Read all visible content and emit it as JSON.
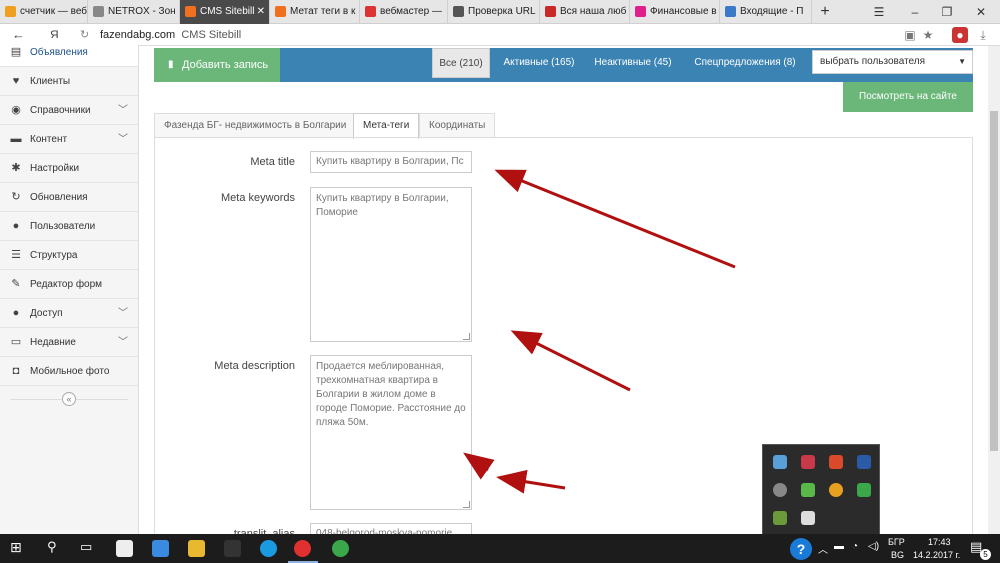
{
  "browser": {
    "tabs": [
      {
        "label": "счетчик — веб",
        "color": "#f0a020"
      },
      {
        "label": "NETROX - Зон",
        "color": "#888888"
      },
      {
        "label": "CMS Sitebill",
        "color": "#f07020"
      },
      {
        "label": "Метат теги в к",
        "color": "#f07020"
      },
      {
        "label": "вебмастер —",
        "color": "#d33333"
      },
      {
        "label": "Проверка URL",
        "color": "#555555"
      },
      {
        "label": "Вся наша люб",
        "color": "#c82828"
      },
      {
        "label": "Финансовые в",
        "color": "#e0208a"
      },
      {
        "label": "Входящие - П",
        "color": "#3a7ac8"
      }
    ],
    "url_domain": "fazendabg.com",
    "url_title": "CMS Sitebill",
    "yandex_glyph": "Я",
    "new_tab": "+",
    "close_tab_glyph": "✕"
  },
  "sidebar": {
    "items": [
      {
        "label": "Объявления",
        "icon": "book-icon",
        "glyph": "▤",
        "chevron": false
      },
      {
        "label": "Клиенты",
        "icon": "heart-icon",
        "glyph": "♥",
        "chevron": false
      },
      {
        "label": "Справочники",
        "icon": "globe-icon",
        "glyph": "◉",
        "chevron": true
      },
      {
        "label": "Контент",
        "icon": "coffee-icon",
        "glyph": "▬",
        "chevron": true
      },
      {
        "label": "Настройки",
        "icon": "gear-icon",
        "glyph": "✱",
        "chevron": false
      },
      {
        "label": "Обновления",
        "icon": "refresh-icon",
        "glyph": "↻",
        "chevron": false
      },
      {
        "label": "Пользователи",
        "icon": "user-icon",
        "glyph": "●",
        "chevron": false
      },
      {
        "label": "Структура",
        "icon": "list-icon",
        "glyph": "☰",
        "chevron": false
      },
      {
        "label": "Редактор форм",
        "icon": "edit-icon",
        "glyph": "✎",
        "chevron": false
      },
      {
        "label": "Доступ",
        "icon": "users-icon",
        "glyph": "●",
        "chevron": true
      },
      {
        "label": "Недавние",
        "icon": "desktop-icon",
        "glyph": "▭",
        "chevron": true
      },
      {
        "label": "Мобильное фото",
        "icon": "camera-icon",
        "glyph": "◘",
        "chevron": false
      }
    ],
    "collapse_glyph": "«"
  },
  "toolbar": {
    "add_label": "Добавить запись",
    "filters": [
      "Все (210)",
      "Активные (165)",
      "Неактивные (45)",
      "Спецпредложения (8)"
    ],
    "user_select": "выбрать пользователя",
    "view_site": "Посмотреть на сайте"
  },
  "page_tabs": [
    "Фазенда БГ- недвижимость в Болгарии",
    "Мета-теги",
    "Координаты"
  ],
  "form": {
    "meta_title_label": "Meta title",
    "meta_title_value": "Купить квартиру в Болгарии, Пс",
    "meta_keywords_label": "Meta keywords",
    "meta_keywords_value": "Купить квартиру в Болгарии, Поморие",
    "meta_description_label": "Meta description",
    "meta_description_value": "Продается меблированная, трехкомнатная квартира в Болгарии в жилом доме в городе Поморие. Расстояние до пляжа 50м.",
    "translit_label": "translit_alias",
    "translit_value": "048-belgorod-moskva-pomorie"
  },
  "taskbar": {
    "lang_1": "БГР",
    "lang_2": "BG",
    "time": "17:43",
    "date": "14.2.2017 г.",
    "notifications": "5",
    "help_glyph": "?"
  },
  "colors": {
    "accent_blue": "#3b83b3",
    "green": "#6bb77a",
    "arrow_red": "#b01010"
  }
}
